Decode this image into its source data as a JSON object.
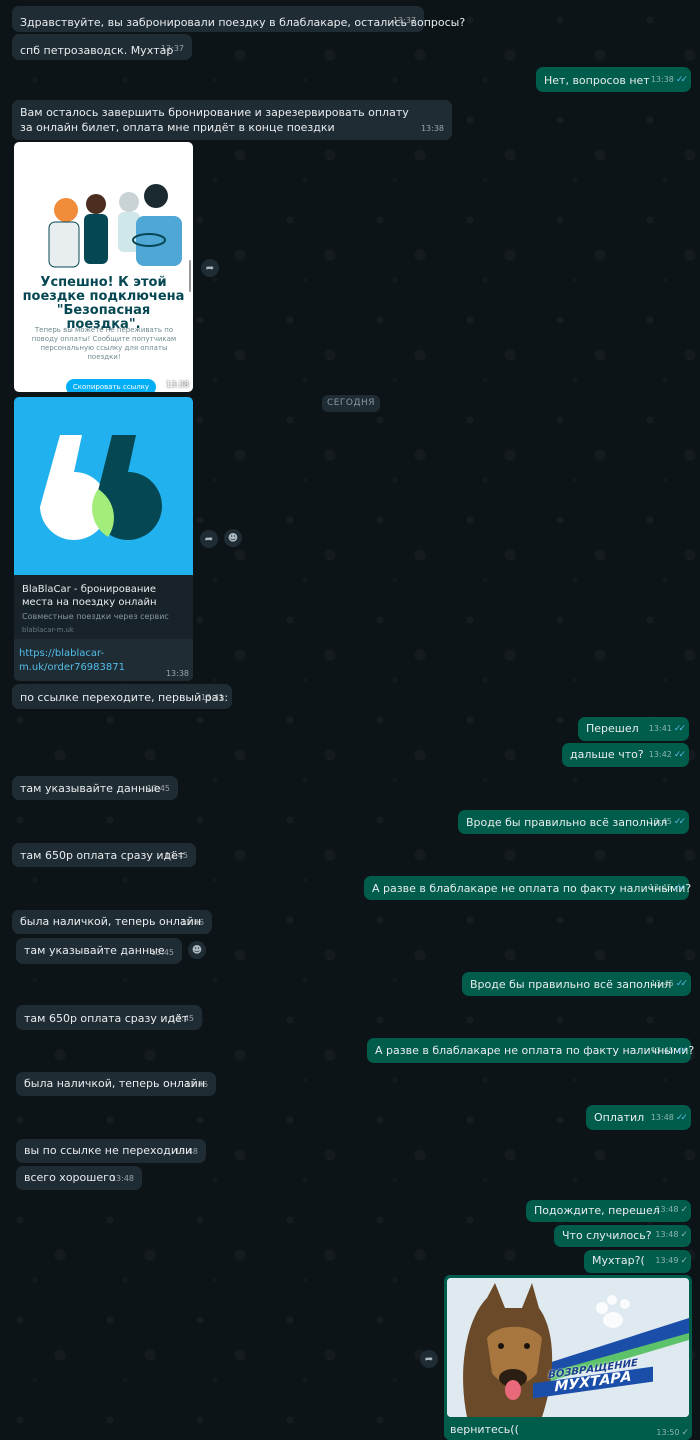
{
  "date_divider": "СЕГОДНЯ",
  "messages": [
    {
      "text": "Здравствуйте, вы забронировали поездку в блаблакаре, остались вопросы?",
      "time": "13:37"
    },
    {
      "text": "спб петрозаводск. Мухтар",
      "time": "13:37"
    },
    {
      "text": "Нет, вопросов нет",
      "time": "13:38"
    },
    {
      "text": "Вам осталось завершить бронирование и зарезервировать оплату за онлайн билет, оплата мне придёт в конце поездки",
      "time": "13:38"
    },
    {
      "text": "по ссылке переходите, первый раз:",
      "time": "13:41"
    },
    {
      "text": "Перешел",
      "time": "13:41"
    },
    {
      "text": "дальше что?",
      "time": "13:42"
    },
    {
      "text": "там указывайте данные",
      "time": "13:45"
    },
    {
      "text": "Вроде бы правильно всё заполнил",
      "time": "13:45"
    },
    {
      "text": "там 650р оплата сразу идёт",
      "time": "13:45"
    },
    {
      "text": "А разве в блаблакаре не оплата по факту наличными?",
      "time": "13:45"
    },
    {
      "text": "была наличкой, теперь онлайн",
      "time": "13:46"
    },
    {
      "text": "там указывайте данные",
      "time": "13:45"
    },
    {
      "text": "Вроде бы правильно всё заполнил",
      "time": "13:45"
    },
    {
      "text": "там 650р оплата сразу идёт",
      "time": "13:45"
    },
    {
      "text": "А разве в блаблакаре не оплата по факту наличными?",
      "time": "13:45"
    },
    {
      "text": "была наличкой, теперь онлайн",
      "time": "13:46"
    },
    {
      "text": "Оплатил",
      "time": "13:48"
    },
    {
      "text": "вы по ссылке не переходили",
      "time": "13:48"
    },
    {
      "text": "всего хорошего",
      "time": "13:48"
    },
    {
      "text": "Подождите, перешел",
      "time": "13:48"
    },
    {
      "text": "Что случилось?",
      "time": "13:48"
    },
    {
      "text": "Мухтар?(",
      "time": "13:49"
    }
  ],
  "screenshot_card": {
    "heading": "Успешно! К этой поездке подключена \"Безопасная поездка\".",
    "subtext": "Теперь вы можете не переживать по поводу оплаты! Сообщите попутчикам персональную ссылку для оплаты поездки!",
    "button": "Скопировать ссылку",
    "time": "13:38"
  },
  "link_card": {
    "title": "BlaBlaCar - бронирование места на поездку онлайн",
    "description": "Совместные поездки через сервис",
    "domain": "blablacar-m.uk",
    "link": "https://blablacar-m.uk/order76983871",
    "time": "13:38",
    "logo_colors": {
      "background": "#20b1ee",
      "left": "#ffffff",
      "right": "#054752",
      "overlap": "#a3ee7a"
    }
  },
  "image_card": {
    "banner_line1": "ВОЗВРАЩЕНИЕ",
    "banner_line2": "МУХТАРА",
    "caption": "вернитесь((",
    "time": "13:50"
  },
  "icons": {
    "forward": "forward-icon",
    "emoji": "emoji-icon",
    "read_ticks": "double-check-icon"
  },
  "colors": {
    "incoming_bubble": "#1f2c33",
    "outgoing_bubble": "#005c4b",
    "read_tick": "#53bdeb",
    "background": "#0d1418"
  }
}
